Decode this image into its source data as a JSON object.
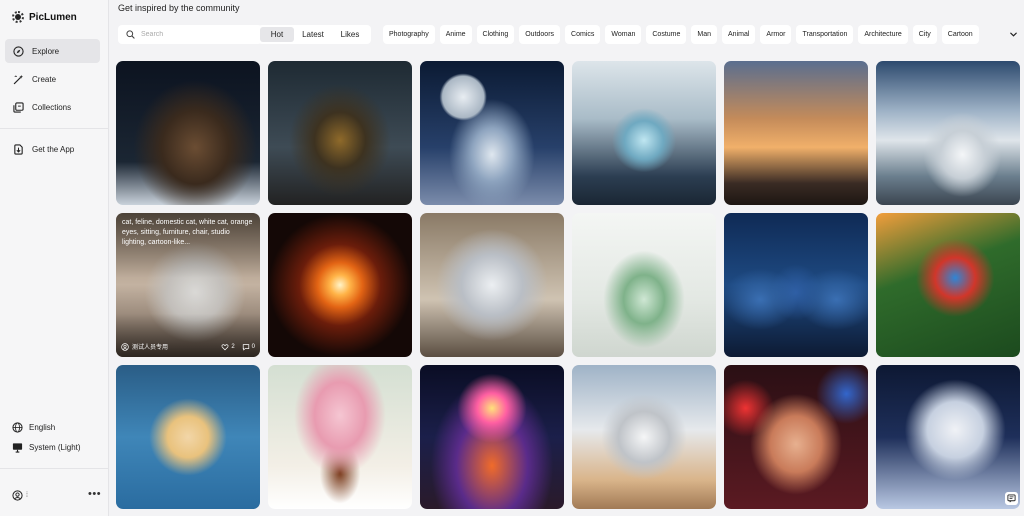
{
  "app": {
    "name": "PicLumen"
  },
  "sidebar": {
    "items": [
      {
        "label": "Explore",
        "icon": "compass-icon",
        "active": true
      },
      {
        "label": "Create",
        "icon": "wand-icon"
      },
      {
        "label": "Collections",
        "icon": "collections-icon"
      }
    ],
    "get_app": {
      "label": "Get the App",
      "icon": "download-app-icon"
    },
    "footer": {
      "language": "English",
      "theme": "System (Light)",
      "more": "•••"
    }
  },
  "main": {
    "heading": "Get inspired by the community",
    "search": {
      "placeholder": "Search",
      "value": ""
    },
    "sort_tabs": [
      {
        "label": "Hot",
        "active": true
      },
      {
        "label": "Latest"
      },
      {
        "label": "Likes"
      }
    ],
    "tags": [
      "Photography",
      "Anime",
      "Clothing",
      "Outdoors",
      "Comics",
      "Woman",
      "Costume",
      "Man",
      "Animal",
      "Armor",
      "Transportation",
      "Architecture",
      "City",
      "Cartoon"
    ],
    "hovered_card": {
      "prompt": "cat, feline, domestic cat, white cat, orange eyes, sitting, furniture, chair, studio lighting, cartoon-like...",
      "user": "测试人员专用",
      "likes": "2",
      "comments": "0"
    }
  },
  "colors": {
    "sidebar_active": "#e5e5e8",
    "background": "#f3f3f5"
  }
}
